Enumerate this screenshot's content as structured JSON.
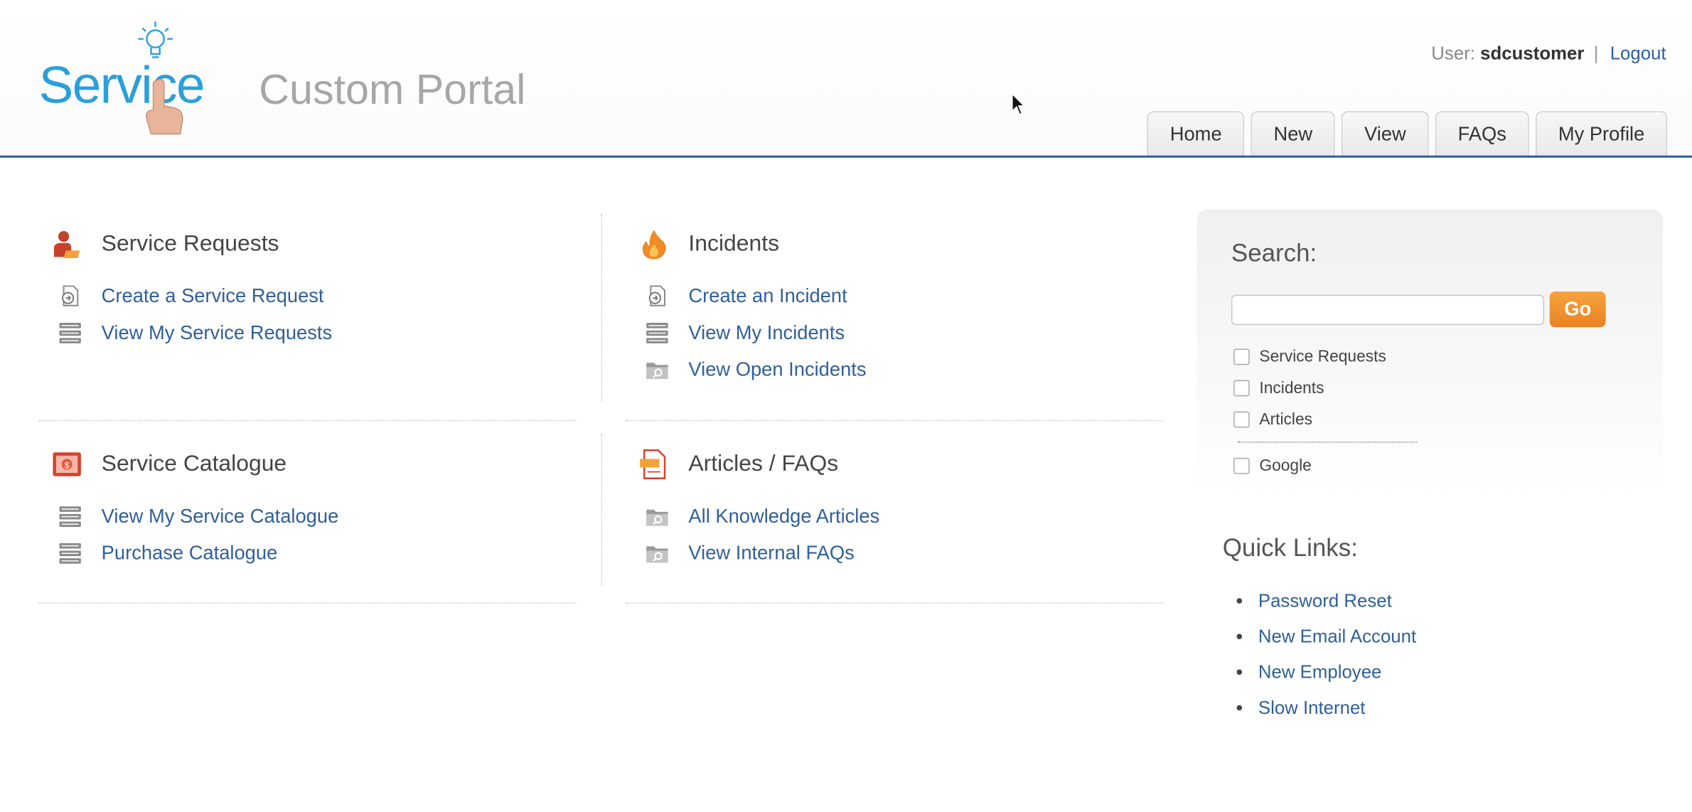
{
  "header": {
    "logo_text": "Service",
    "portal_title": "Custom Portal",
    "user_label": "User:",
    "username": "sdcustomer",
    "separator": "|",
    "logout_label": "Logout",
    "accent_color": "#2f5f9a"
  },
  "tabs": [
    {
      "label": "Home"
    },
    {
      "label": "New"
    },
    {
      "label": "View"
    },
    {
      "label": "FAQs"
    },
    {
      "label": "My Profile"
    }
  ],
  "sections": {
    "service_requests": {
      "title": "Service Requests",
      "icon": "user-request-icon",
      "links": [
        {
          "label": "Create a Service Request",
          "icon": "create-document-icon"
        },
        {
          "label": "View My Service Requests",
          "icon": "list-icon"
        }
      ]
    },
    "incidents": {
      "title": "Incidents",
      "icon": "fire-icon",
      "links": [
        {
          "label": "Create an Incident",
          "icon": "create-document-icon"
        },
        {
          "label": "View My Incidents",
          "icon": "list-icon"
        },
        {
          "label": "View Open Incidents",
          "icon": "folder-search-icon"
        }
      ]
    },
    "service_catalogue": {
      "title": "Service Catalogue",
      "icon": "catalogue-icon",
      "links": [
        {
          "label": "View My Service Catalogue",
          "icon": "list-icon"
        },
        {
          "label": "Purchase Catalogue",
          "icon": "list-icon"
        }
      ]
    },
    "articles": {
      "title": "Articles / FAQs",
      "icon": "article-icon",
      "links": [
        {
          "label": "All Knowledge Articles",
          "icon": "folder-search-icon"
        },
        {
          "label": "View Internal FAQs",
          "icon": "folder-search-icon"
        }
      ]
    }
  },
  "search": {
    "title": "Search:",
    "input_value": "",
    "go_label": "Go",
    "go_color": "#f0922e",
    "options": [
      {
        "label": "Service Requests",
        "checked": false
      },
      {
        "label": "Incidents",
        "checked": false
      },
      {
        "label": "Articles",
        "checked": false
      }
    ],
    "google_label": "Google",
    "google_checked": false
  },
  "quick_links": {
    "title": "Quick Links:",
    "items": [
      {
        "label": "Password Reset"
      },
      {
        "label": "New Email Account"
      },
      {
        "label": "New Employee"
      },
      {
        "label": "Slow Internet"
      }
    ]
  }
}
